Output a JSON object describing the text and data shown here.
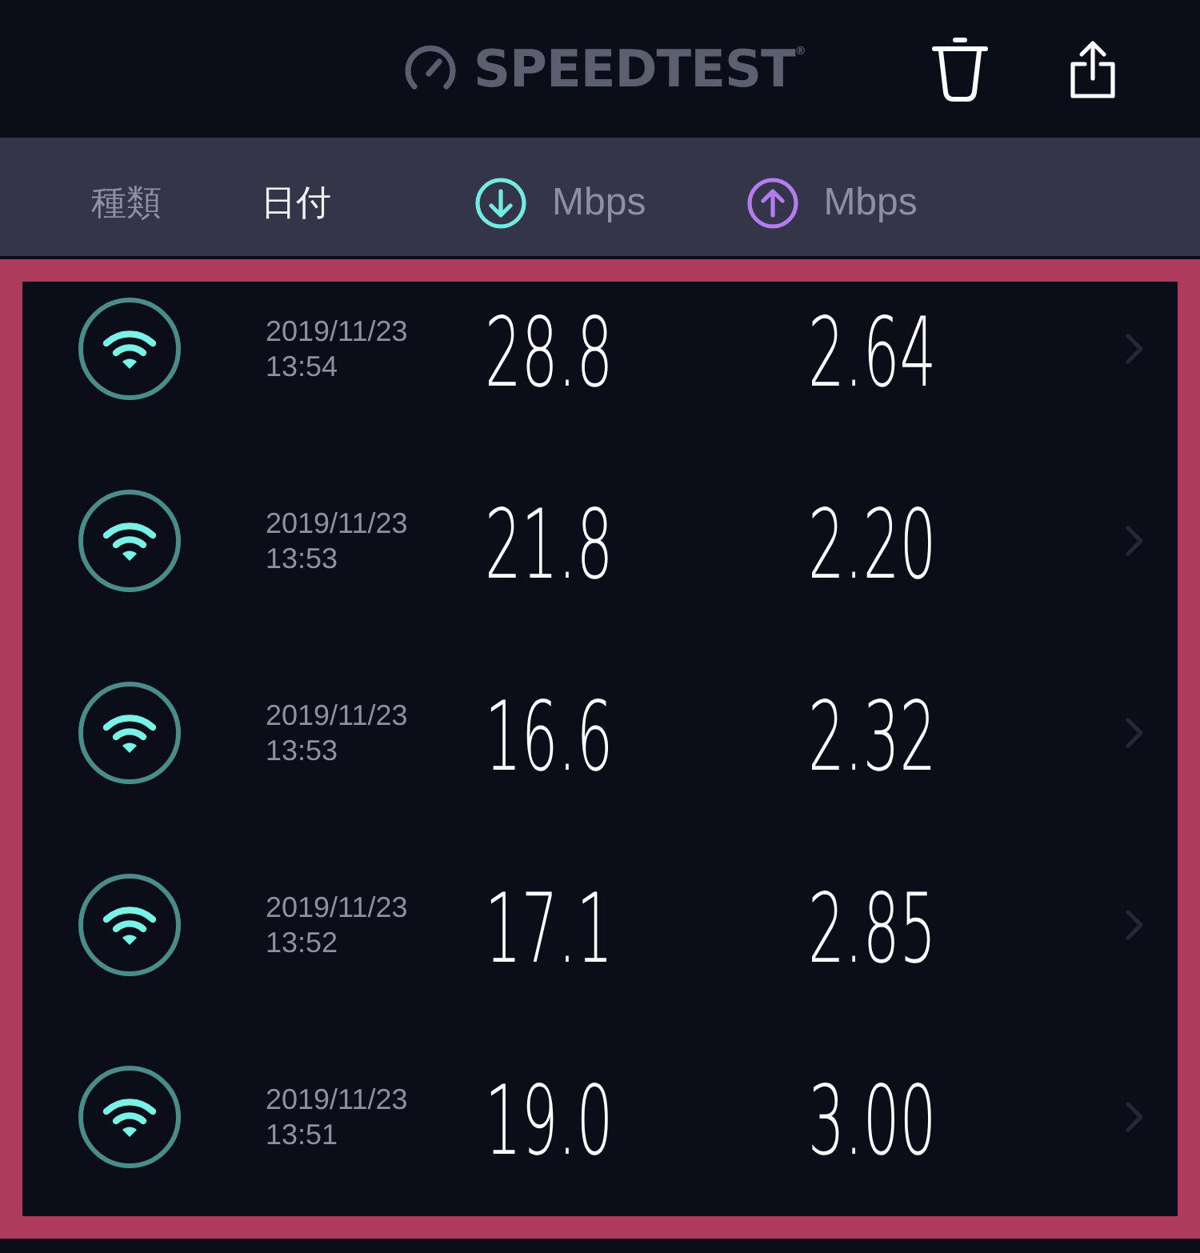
{
  "header": {
    "logo": "SPEEDTEST$^{®}$"
  },
  "columns": [
    {
      "kind": "text",
      "label": "種類",
      "selected": false
    },
    {
      "kind": "text",
      "label": "日付",
      "selected": true
    },
    {
      "kind": "download",
      "label": "Mbps",
      "selected": false
    },
    {
      "kind": "upload",
      "label": "Mbps",
      "selected": false
    }
  ],
  "results": [
    {
      "kind": "wifi",
      "date": "2019/11/23",
      "time": "13:54",
      "download": "28.8",
      "upload": "2.64"
    },
    {
      "kind": "wifi",
      "date": "2019/11/23",
      "time": "13:53",
      "download": "21.8",
      "upload": "2.20"
    },
    {
      "kind": "wifi",
      "date": "2019/11/23",
      "time": "13:53",
      "download": "16.6",
      "upload": "2.32"
    },
    {
      "kind": "wifi",
      "date": "2019/11/23",
      "time": "13:52",
      "download": "17.1",
      "upload": "2.85"
    },
    {
      "kind": "wifi",
      "date": "2019/11/23",
      "time": "13:51",
      "download": "19.0",
      "upload": "3.00"
    }
  ]
}
